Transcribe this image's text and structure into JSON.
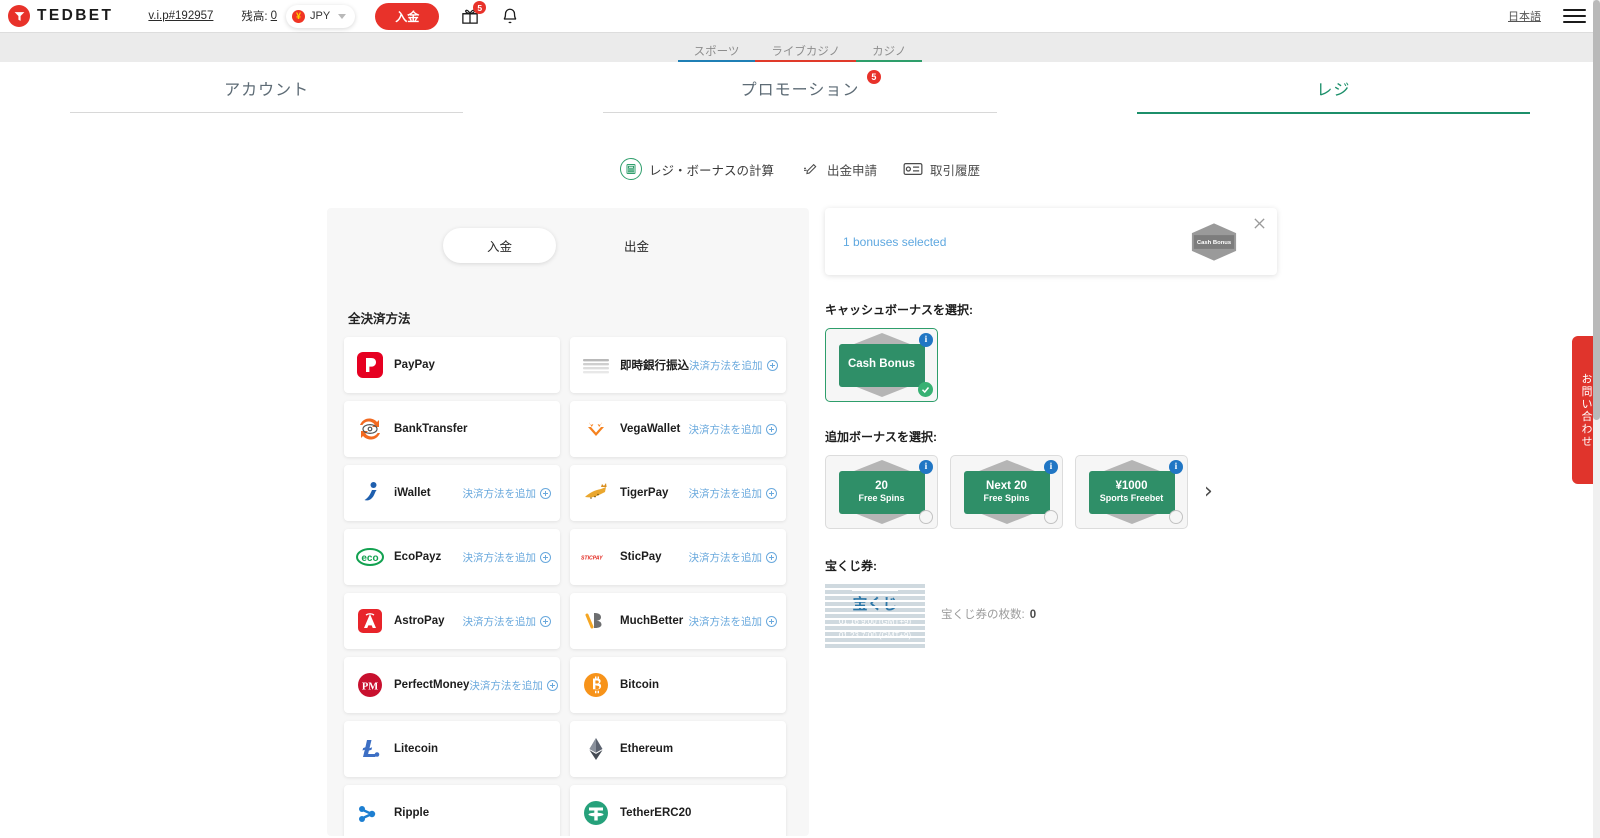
{
  "header": {
    "brand": "TEDBET",
    "brand_icon": "tedbet-logo-icon",
    "vip_link": "v.i.p#192957",
    "balance_label": "残高:",
    "balance_value": "0",
    "currency": "JPY",
    "currency_symbol": "¥",
    "deposit_button": "入金",
    "gift_icon": "gift-icon",
    "gift_badge": "5",
    "bell_icon": "bell-icon",
    "language": "日本語",
    "menu_icon": "hamburger-menu-icon"
  },
  "categories": [
    {
      "label": "スポーツ",
      "color": "#1f7fb5"
    },
    {
      "label": "ライブカジノ",
      "color": "#e03a2a"
    },
    {
      "label": "カジノ",
      "color": "#2e9e6b"
    }
  ],
  "main_tabs": [
    {
      "label": "アカウント",
      "active": false,
      "badge": null
    },
    {
      "label": "プロモーション",
      "active": false,
      "badge": "5"
    },
    {
      "label": "レジ",
      "active": true,
      "badge": null
    }
  ],
  "sub_actions": [
    {
      "label": "レジ・ボーナスの計算",
      "icon": "calculator-icon"
    },
    {
      "label": "出金申請",
      "icon": "pencil-icon"
    },
    {
      "label": "取引履歴",
      "icon": "card-history-icon"
    }
  ],
  "cashier": {
    "toggle": [
      {
        "label": "入金",
        "active": true
      },
      {
        "label": "出金",
        "active": false
      }
    ],
    "section_title": "全決済方法",
    "add_method_label": "決済方法を追加",
    "payment_methods": [
      {
        "name": "PayPay",
        "icon": "paypay-logo",
        "add": false
      },
      {
        "name": "即時銀行振込",
        "icon": "instant-bank-logo",
        "add": true
      },
      {
        "name": "BankTransfer",
        "icon": "banktransfer-logo",
        "add": false
      },
      {
        "name": "VegaWallet",
        "icon": "vegawallet-logo",
        "add": true
      },
      {
        "name": "iWallet",
        "icon": "iwallet-logo",
        "add": true
      },
      {
        "name": "TigerPay",
        "icon": "tigerpay-logo",
        "add": true
      },
      {
        "name": "EcoPayz",
        "icon": "ecopayz-logo",
        "add": true
      },
      {
        "name": "SticPay",
        "icon": "sticpay-logo",
        "add": true
      },
      {
        "name": "AstroPay",
        "icon": "astropay-logo",
        "add": true
      },
      {
        "name": "MuchBetter",
        "icon": "muchbetter-logo",
        "add": true
      },
      {
        "name": "PerfectMoney",
        "icon": "perfectmoney-logo",
        "add": true
      },
      {
        "name": "Bitcoin",
        "icon": "bitcoin-logo",
        "add": false
      },
      {
        "name": "Litecoin",
        "icon": "litecoin-logo",
        "add": false
      },
      {
        "name": "Ethereum",
        "icon": "ethereum-logo",
        "add": false
      },
      {
        "name": "Ripple",
        "icon": "ripple-logo",
        "add": false
      },
      {
        "name": "TetherERC20",
        "icon": "tether-logo",
        "add": false
      }
    ]
  },
  "bonus": {
    "banner_text": "1 bonuses selected",
    "banner_hex_label": "Cash Bonus",
    "banner_close_icon": "close-icon",
    "cash_label": "キャッシュボーナスを選択:",
    "cash_bonuses": [
      {
        "line1": "Cash Bonus",
        "line2": "",
        "selected": true
      }
    ],
    "extra_label": "追加ボーナスを選択:",
    "extra_bonuses": [
      {
        "line1": "20",
        "line2": "Free Spins",
        "selected": false
      },
      {
        "line1": "Next 20",
        "line2": "Free Spins",
        "selected": false
      },
      {
        "line1": "¥1000",
        "line2": "Sports Freebet",
        "selected": false
      }
    ],
    "carousel_next_icon": "chevron-right-icon",
    "lottery_label": "宝くじ券:",
    "lottery_ticket_title": "宝くじ",
    "lottery_date_start": "01.16 9:00 (GMT+9)",
    "lottery_date_end": "01.23 7:00 (GMT+9)",
    "lottery_count_label": "宝くじ券の枚数:",
    "lottery_count_value": "0"
  },
  "contact_tab": {
    "label": "お問い合わせ"
  },
  "colors": {
    "brand_red": "#e8322a",
    "accent_green": "#2e9e6b",
    "link_blue": "#6aa9dd",
    "panel_bg": "#f7f7f7"
  }
}
